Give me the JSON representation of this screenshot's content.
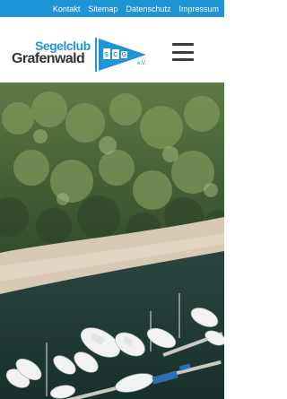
{
  "topnav": {
    "items": [
      {
        "label": "Kontakt"
      },
      {
        "label": "Sitemap"
      },
      {
        "label": "Datenschutz"
      },
      {
        "label": "Impressum"
      }
    ]
  },
  "logo": {
    "line1": "Segelclub",
    "line2": "Grafenwald",
    "flag_letters": "SCG",
    "suffix": "e.V."
  },
  "colors": {
    "topbar": "#1f94d6",
    "brand_blue": "#1f94d6",
    "brand_dark": "#333333",
    "menu_icon": "#3a3a3a"
  },
  "icons": {
    "menu": "hamburger-menu-icon"
  }
}
